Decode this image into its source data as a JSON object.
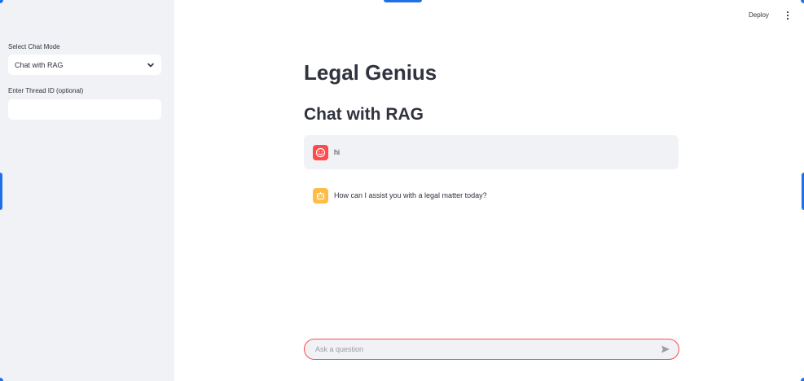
{
  "sidebar": {
    "chat_mode_label": "Select Chat Mode",
    "chat_mode_value": "Chat with RAG",
    "thread_id_label": "Enter Thread ID (optional)",
    "thread_id_value": ""
  },
  "header": {
    "deploy_label": "Deploy"
  },
  "main": {
    "title": "Legal Genius",
    "subtitle": "Chat with RAG",
    "messages": [
      {
        "role": "user",
        "text": "hi",
        "avatar_icon": "user-face-icon"
      },
      {
        "role": "assistant",
        "text": "How can I assist you with a legal matter today?",
        "avatar_icon": "bot-icon"
      }
    ]
  },
  "chat_input": {
    "placeholder": "Ask a question",
    "value": ""
  },
  "colors": {
    "sidebar_bg": "#f0f2f6",
    "primary": "#ff4b4b",
    "bot_avatar": "#ffbd45",
    "text": "#31333f",
    "edge_accent": "#1f6feb"
  }
}
